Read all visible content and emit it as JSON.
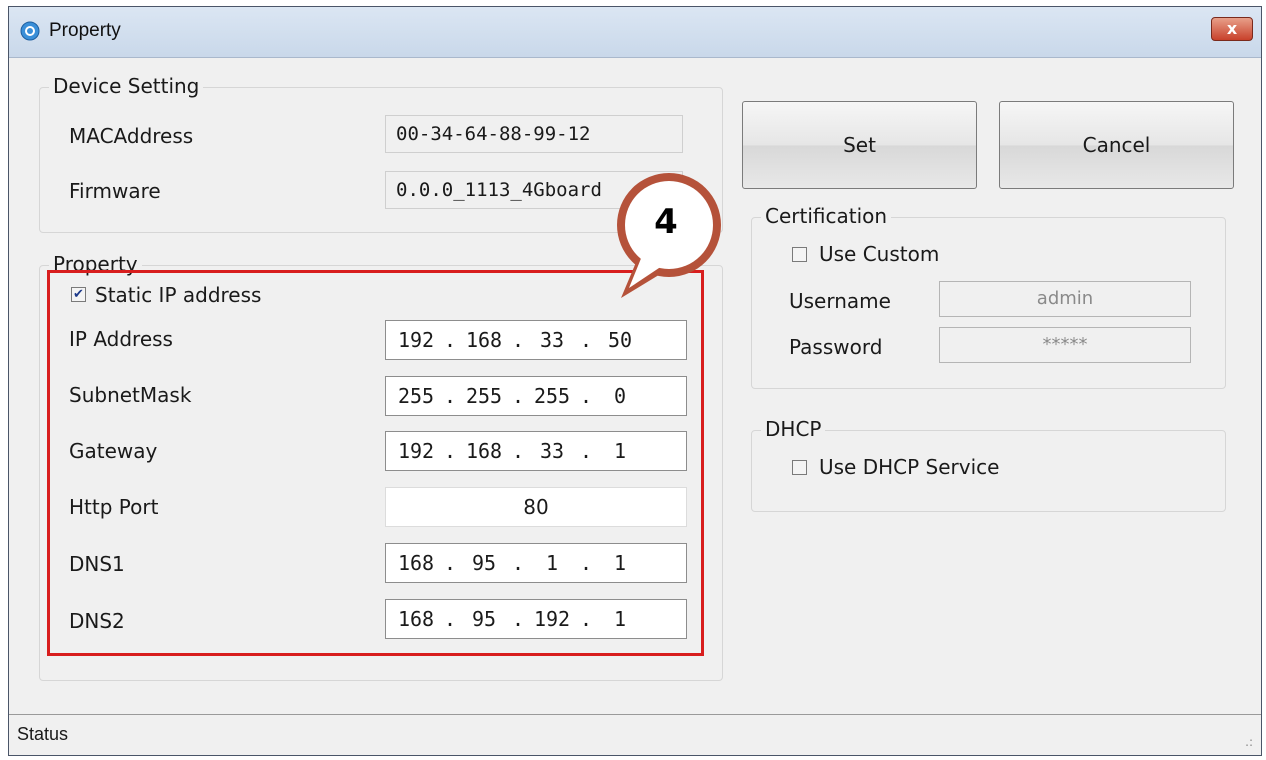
{
  "window": {
    "title": "Property",
    "close_symbol": "x"
  },
  "device_setting": {
    "legend": "Device Setting",
    "mac_label": "MACAddress",
    "mac_value": "00-34-64-88-99-12",
    "firmware_label": "Firmware",
    "firmware_value": "0.0.0_1113_4Gboard"
  },
  "property": {
    "legend": "Property",
    "static_ip_label": "Static IP address",
    "static_ip_checked": true,
    "ip_label": "IP Address",
    "ip_octets": [
      "192",
      "168",
      "33",
      "50"
    ],
    "subnet_label": "SubnetMask",
    "subnet_octets": [
      "255",
      "255",
      "255",
      "0"
    ],
    "gateway_label": "Gateway",
    "gateway_octets": [
      "192",
      "168",
      "33",
      "1"
    ],
    "http_port_label": "Http Port",
    "http_port_value": "80",
    "dns1_label": "DNS1",
    "dns1_octets": [
      "168",
      "95",
      "1",
      "1"
    ],
    "dns2_label": "DNS2",
    "dns2_octets": [
      "168",
      "95",
      "192",
      "1"
    ]
  },
  "buttons": {
    "set": "Set",
    "cancel": "Cancel"
  },
  "certification": {
    "legend": "Certification",
    "use_custom_label": "Use Custom",
    "use_custom_checked": false,
    "username_label": "Username",
    "username_value": "admin",
    "password_label": "Password",
    "password_value": "*****"
  },
  "dhcp": {
    "legend": "DHCP",
    "use_dhcp_label": "Use DHCP Service",
    "use_dhcp_checked": false
  },
  "status_bar": {
    "text": "Status",
    "grip": ".:"
  },
  "callout": {
    "number": "4"
  },
  "colors": {
    "highlight": "#d81e1e",
    "callout_ring": "#b5523a"
  }
}
